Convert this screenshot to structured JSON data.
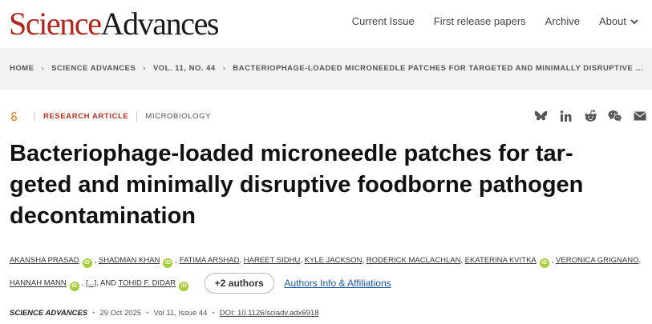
{
  "header": {
    "logo_science": "Science",
    "logo_advances": "Advances",
    "nav": [
      "Current Issue",
      "First release papers",
      "Archive"
    ],
    "about": "About"
  },
  "breadcrumb": {
    "items": [
      "HOME",
      "SCIENCE ADVANCES",
      "VOL. 11, NO. 44"
    ],
    "current": "BACTERIOPHAGE-LOADED MICRONEEDLE PATCHES FOR TARGETED AND MINIMALLY DISRUPTIVE FOODBORN..."
  },
  "article": {
    "type": "RESEARCH ARTICLE",
    "subject": "MICROBIOLOGY",
    "title": "Bacteriophage-loaded microneedle patches for tar-geted and minimally disruptive foodborne pathogen decontamination",
    "title_lines": [
      "Bacteriophage-loaded microneedle patches for tar-",
      "geted and minimally disruptive foodborne pathogen",
      "decontamination"
    ]
  },
  "share_icons": [
    "bluesky-icon",
    "linkedin-icon",
    "reddit-icon",
    "wechat-icon",
    "email-icon"
  ],
  "authors": {
    "list": [
      {
        "name": "Akansha Prasad",
        "orcid": true
      },
      {
        "name": "Shadman Khan",
        "orcid": true
      },
      {
        "name": "Fatima Arshad",
        "orcid": false
      },
      {
        "name": "Hareet Sidhu",
        "orcid": false
      },
      {
        "name": "Kyle Jackson",
        "orcid": false
      },
      {
        "name": "Roderick MacLachlan",
        "orcid": false
      },
      {
        "name": "Ekaterina Kvitka",
        "orcid": true
      },
      {
        "name": "Veronica Grignano",
        "orcid": false
      },
      {
        "name": "Hannah Mann",
        "orcid": true
      },
      {
        "name": "[...]",
        "orcid": false
      },
      {
        "name": "Tohid F. Didar",
        "orcid": true
      }
    ],
    "more_button": "+2 authors",
    "affiliations_link": "Authors Info & Affiliations",
    "and_text": "AND"
  },
  "pub": {
    "journal": "Science Advances",
    "date": "29 Oct 2025",
    "volume": "Vol 11, Issue 44",
    "doi": "DOI: 10.1126/sciadv.adx6918"
  },
  "colors": {
    "brand_red": "#b3241a",
    "orcid_green": "#a6ce39",
    "link_blue": "#1a57a6"
  }
}
